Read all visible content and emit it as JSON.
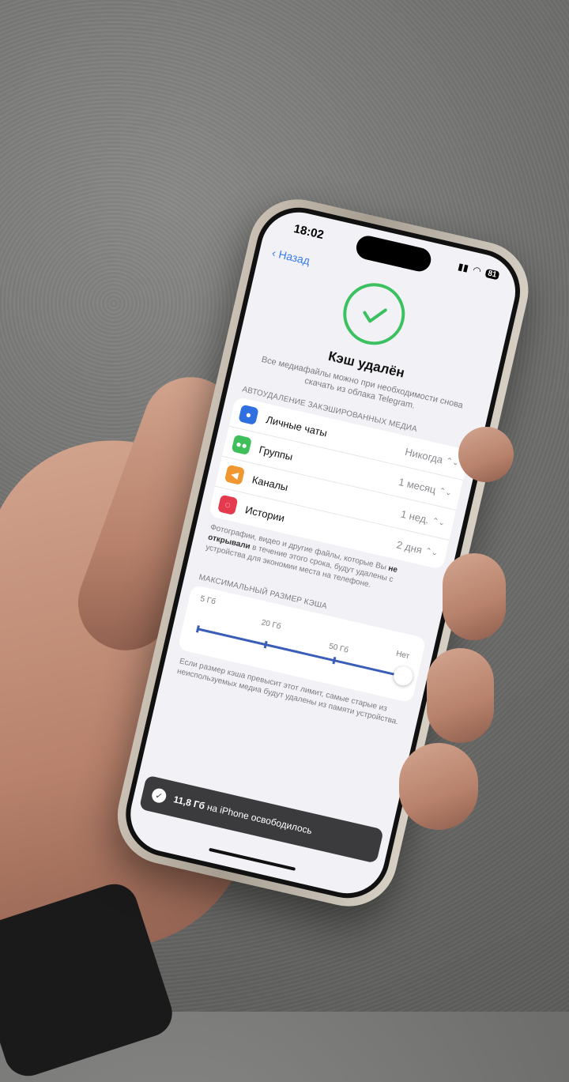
{
  "status": {
    "time": "18:02",
    "battery": "81"
  },
  "nav": {
    "back_label": "Назад"
  },
  "hero": {
    "title": "Кэш удалён",
    "subtitle": "Все медиафайлы можно при необходимости снова скачать из облака Telegram."
  },
  "autodelete": {
    "header": "Автоудаление закэшированных медиа",
    "rows": [
      {
        "label": "Личные чаты",
        "value": "Никогда",
        "icon": "person-icon",
        "color": "#2f6fe0"
      },
      {
        "label": "Группы",
        "value": "1 месяц",
        "icon": "group-icon",
        "color": "#3fbf5a"
      },
      {
        "label": "Каналы",
        "value": "1 нед.",
        "icon": "megaphone-icon",
        "color": "#f0972f"
      },
      {
        "label": "Истории",
        "value": "2 дня",
        "icon": "stories-icon",
        "color": "#e5394d"
      }
    ],
    "note_part1": "Фотографии, видео и другие файлы, которые Вы ",
    "note_bold": "не открывали",
    "note_part2": " в течение этого срока, будут удалены с устройства для экономии места на телефоне."
  },
  "cache_size": {
    "header": "Максимальный размер кэша",
    "ticks": [
      "5 Гб",
      "20 Гб",
      "50 Гб",
      "Нет"
    ],
    "selected": "Нет",
    "note": "Если размер кэша превысит этот лимит, самые старые из неиспользуемых медиа будут удалены из памяти устройства."
  },
  "toast": {
    "amount": "11,8 Гб",
    "text": " на iPhone освободилось"
  },
  "colors": {
    "accent": "#3a7cf0",
    "success": "#3cc160",
    "slider": "#3a5db8"
  }
}
